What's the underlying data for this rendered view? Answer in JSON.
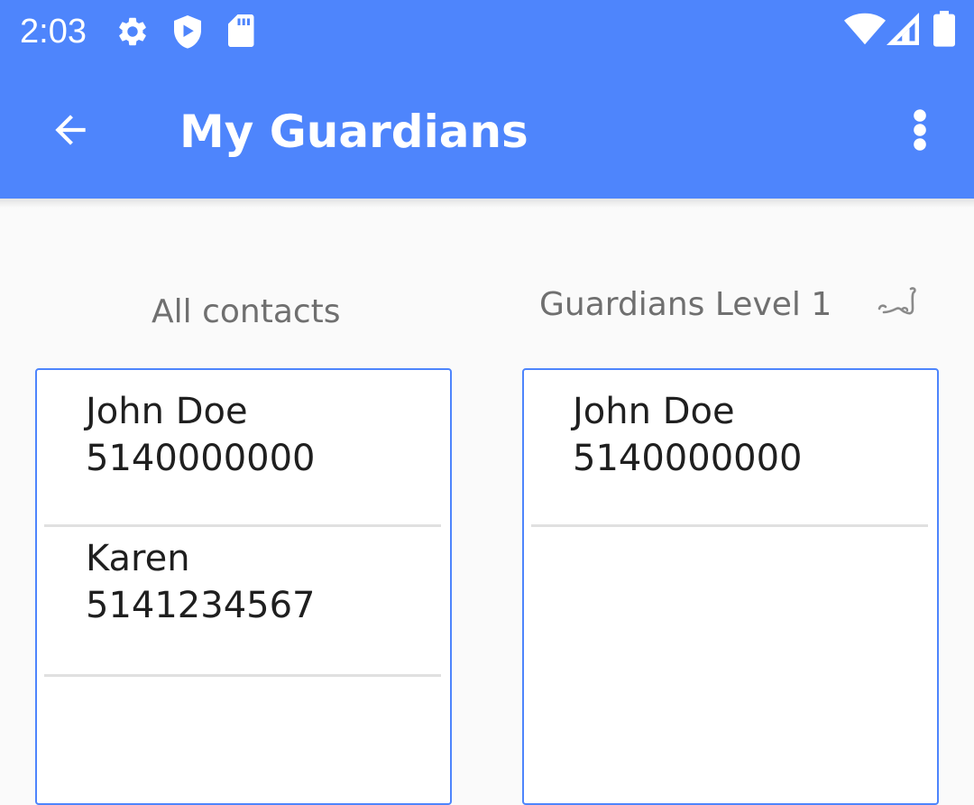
{
  "status_bar": {
    "time": "2:03",
    "icons": [
      "settings-gear-icon",
      "shield-play-icon",
      "sd-card-icon",
      "wifi-icon",
      "cell-signal-icon",
      "battery-icon"
    ]
  },
  "app_bar": {
    "title": "My Guardians",
    "back_icon": "arrow-back-icon",
    "menu_icon": "more-vert-icon",
    "color": "#4e85fc"
  },
  "all_contacts": {
    "heading": "All contacts",
    "items": [
      {
        "name": "John Doe",
        "phone": "5140000000"
      },
      {
        "name": "Karen",
        "phone": "5141234567"
      }
    ]
  },
  "guardians": {
    "heading": "Guardians Level 1",
    "items": [
      {
        "name": "John Doe",
        "phone": "5140000000"
      }
    ]
  }
}
